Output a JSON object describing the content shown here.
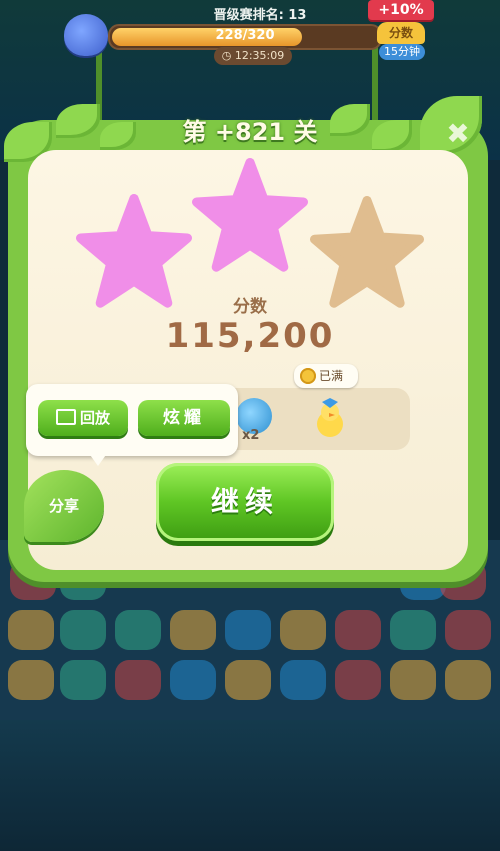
{
  "hud": {
    "rank_text": "晋级赛排名: 13",
    "progress_text": "228/320",
    "progress_fraction": 0.7125,
    "timer": "12:35:09",
    "bonus": "+10%",
    "score_badge": "分数",
    "time_badge": "15分钟"
  },
  "panel": {
    "level_title": "第 +821 关",
    "close_label": "✖",
    "stars_earned": 2,
    "stars_total": 3,
    "score_label": "分数",
    "score_value": "115,200"
  },
  "rewards": {
    "item_count": "x2",
    "full_label": "已满"
  },
  "share_popup": {
    "replay_label": "回放",
    "show_label": "炫耀"
  },
  "buttons": {
    "share_label": "分享",
    "continue_label": "继续"
  },
  "colors": {
    "star_earned": "#f08ee8",
    "star_empty": "#e0bd8f",
    "button_green": "#5fc624",
    "panel_green": "#7fc844"
  }
}
